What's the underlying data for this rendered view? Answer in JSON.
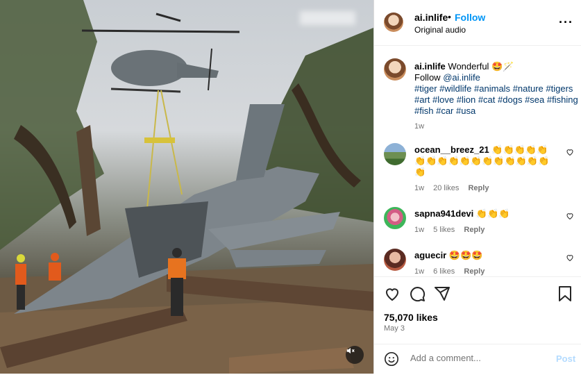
{
  "header": {
    "username": "ai.inlife",
    "separator": "•",
    "follow_label": "Follow",
    "audio_label": "Original audio",
    "more_icon": "more-horizontal-icon"
  },
  "caption": {
    "username": "ai.inlife",
    "text": "Wonderful 🤩🪄",
    "follow_prefix": "Follow",
    "mention": "@ai.inlife",
    "hashtags": [
      "#tiger",
      "#wildlife",
      "#animals",
      "#nature",
      "#tigers",
      "#art",
      "#love",
      "#lion",
      "#cat",
      "#dogs",
      "#sea",
      "#fishing",
      "#fish",
      "#car",
      "#usa"
    ],
    "time": "1w"
  },
  "comments": [
    {
      "username": "ocean__breez_21",
      "text": "👏👏👏👏👏👏👏👏👏👏👏👏👏👏👏👏👏👏",
      "time": "1w",
      "likes": "20 likes",
      "reply": "Reply"
    },
    {
      "username": "sapna941devi",
      "text": "👏👏👏",
      "time": "1w",
      "likes": "5 likes",
      "reply": "Reply"
    },
    {
      "username": "aguecir",
      "text": "🤩🤩🤩",
      "time": "1w",
      "likes": "6 likes",
      "reply": "Reply"
    }
  ],
  "actions": {
    "like_icon": "heart-icon",
    "comment_icon": "comment-icon",
    "share_icon": "share-icon",
    "save_icon": "bookmark-icon",
    "likes": "75,070 likes",
    "date": "May 3"
  },
  "add_comment": {
    "placeholder": "Add a comment...",
    "post_label": "Post",
    "emoji_icon": "emoji-icon"
  },
  "media": {
    "mute_icon": "muted-speaker-icon"
  }
}
